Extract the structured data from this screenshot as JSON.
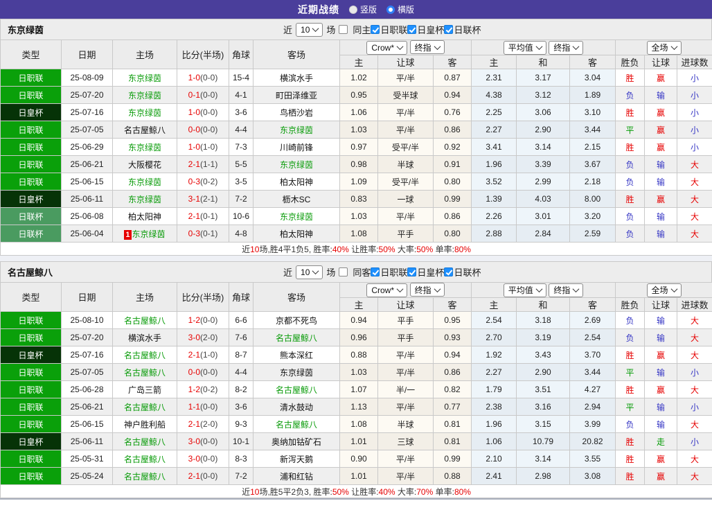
{
  "title_bar": {
    "title": "近期战绩",
    "vertical": "竖版",
    "horizontal": "横版"
  },
  "filters": {
    "near": "近",
    "count": "10",
    "games": "场"
  },
  "table_header": {
    "left_cols": [
      "类型",
      "日期",
      "主场",
      "比分(半场)",
      "角球",
      "客场"
    ],
    "crow_select": "Crow*",
    "final_select": "终指",
    "avg_select": "平均值",
    "avg_final_select": "终指",
    "full_select": "全场",
    "sub_cols": [
      "主",
      "让球",
      "客",
      "主",
      "和",
      "客",
      "胜负",
      "让球",
      "进球数"
    ]
  },
  "colors": {
    "accent_purple": "#4a3e9b",
    "league_green": "#0aa00a",
    "cup_dark_green": "#063307",
    "leaguecup_green": "#4a9b60",
    "focus_team_green": "#089b08",
    "win_red": "#e60000",
    "lose_blue": "#3535c4",
    "checkbox_blue": "#1e90ff"
  },
  "sections": [
    {
      "team": "东京绿茵",
      "same_label": "同主",
      "league_filters": [
        "日职联",
        "日皇杯",
        "日联杯"
      ],
      "rows": [
        {
          "type": "日职联",
          "tc": "jl",
          "date": "25-08-09",
          "home": "东京绿茵",
          "hf": true,
          "badge": "",
          "score": "1-0",
          "half": "(0-0)",
          "corner": "15-4",
          "away": "横滨水手",
          "af": false,
          "c1": "1.02",
          "hc": "平/半",
          "c2": "0.87",
          "m1": "2.31",
          "m2": "3.17",
          "m3": "3.04",
          "r1": "胜",
          "r1c": "red",
          "r2": "赢",
          "r2c": "red",
          "r3": "小",
          "r3c": "blue"
        },
        {
          "type": "日职联",
          "tc": "jl",
          "date": "25-07-20",
          "home": "东京绿茵",
          "hf": true,
          "badge": "",
          "score": "0-1",
          "half": "(0-0)",
          "corner": "4-1",
          "away": "町田泽维亚",
          "af": false,
          "c1": "0.95",
          "hc": "受半球",
          "c2": "0.94",
          "m1": "4.38",
          "m2": "3.12",
          "m3": "1.89",
          "r1": "负",
          "r1c": "blue",
          "r2": "输",
          "r2c": "blue",
          "r3": "小",
          "r3c": "blue"
        },
        {
          "type": "日皇杯",
          "tc": "cup",
          "date": "25-07-16",
          "home": "东京绿茵",
          "hf": true,
          "badge": "",
          "score": "1-0",
          "half": "(0-0)",
          "corner": "3-6",
          "away": "鸟栖沙岩",
          "af": false,
          "c1": "1.06",
          "hc": "平/半",
          "c2": "0.76",
          "m1": "2.25",
          "m2": "3.06",
          "m3": "3.10",
          "r1": "胜",
          "r1c": "red",
          "r2": "赢",
          "r2c": "red",
          "r3": "小",
          "r3c": "blue"
        },
        {
          "type": "日职联",
          "tc": "jl",
          "date": "25-07-05",
          "home": "名古屋鲸八",
          "hf": false,
          "badge": "",
          "score": "0-0",
          "half": "(0-0)",
          "corner": "4-4",
          "away": "东京绿茵",
          "af": true,
          "c1": "1.03",
          "hc": "平/半",
          "c2": "0.86",
          "m1": "2.27",
          "m2": "2.90",
          "m3": "3.44",
          "r1": "平",
          "r1c": "green",
          "r2": "赢",
          "r2c": "red",
          "r3": "小",
          "r3c": "blue"
        },
        {
          "type": "日职联",
          "tc": "jl",
          "date": "25-06-29",
          "home": "东京绿茵",
          "hf": true,
          "badge": "",
          "score": "1-0",
          "half": "(1-0)",
          "corner": "7-3",
          "away": "川崎前锋",
          "af": false,
          "c1": "0.97",
          "hc": "受平/半",
          "c2": "0.92",
          "m1": "3.41",
          "m2": "3.14",
          "m3": "2.15",
          "r1": "胜",
          "r1c": "red",
          "r2": "赢",
          "r2c": "red",
          "r3": "小",
          "r3c": "blue"
        },
        {
          "type": "日职联",
          "tc": "jl",
          "date": "25-06-21",
          "home": "大阪樱花",
          "hf": false,
          "badge": "",
          "score": "2-1",
          "half": "(1-1)",
          "corner": "5-5",
          "away": "东京绿茵",
          "af": true,
          "c1": "0.98",
          "hc": "半球",
          "c2": "0.91",
          "m1": "1.96",
          "m2": "3.39",
          "m3": "3.67",
          "r1": "负",
          "r1c": "blue",
          "r2": "输",
          "r2c": "blue",
          "r3": "大",
          "r3c": "red"
        },
        {
          "type": "日职联",
          "tc": "jl",
          "date": "25-06-15",
          "home": "东京绿茵",
          "hf": true,
          "badge": "",
          "score": "0-3",
          "half": "(0-2)",
          "corner": "3-5",
          "away": "柏太阳神",
          "af": false,
          "c1": "1.09",
          "hc": "受平/半",
          "c2": "0.80",
          "m1": "3.52",
          "m2": "2.99",
          "m3": "2.18",
          "r1": "负",
          "r1c": "blue",
          "r2": "输",
          "r2c": "blue",
          "r3": "大",
          "r3c": "red"
        },
        {
          "type": "日皇杯",
          "tc": "cup",
          "date": "25-06-11",
          "home": "东京绿茵",
          "hf": true,
          "badge": "",
          "score": "3-1",
          "half": "(2-1)",
          "corner": "7-2",
          "away": "枥木SC",
          "af": false,
          "c1": "0.83",
          "hc": "一球",
          "c2": "0.99",
          "m1": "1.39",
          "m2": "4.03",
          "m3": "8.00",
          "r1": "胜",
          "r1c": "red",
          "r2": "赢",
          "r2c": "red",
          "r3": "大",
          "r3c": "red"
        },
        {
          "type": "日联杯",
          "tc": "lc",
          "date": "25-06-08",
          "home": "柏太阳神",
          "hf": false,
          "badge": "",
          "score": "2-1",
          "half": "(0-1)",
          "corner": "10-6",
          "away": "东京绿茵",
          "af": true,
          "c1": "1.03",
          "hc": "平/半",
          "c2": "0.86",
          "m1": "2.26",
          "m2": "3.01",
          "m3": "3.20",
          "r1": "负",
          "r1c": "blue",
          "r2": "输",
          "r2c": "blue",
          "r3": "大",
          "r3c": "red"
        },
        {
          "type": "日联杯",
          "tc": "lc",
          "date": "25-06-04",
          "home": "东京绿茵",
          "hf": true,
          "badge": "1",
          "score": "0-3",
          "half": "(0-1)",
          "corner": "4-8",
          "away": "柏太阳神",
          "af": false,
          "c1": "1.08",
          "hc": "平手",
          "c2": "0.80",
          "m1": "2.88",
          "m2": "2.84",
          "m3": "2.59",
          "r1": "负",
          "r1c": "blue",
          "r2": "输",
          "r2c": "blue",
          "r3": "大",
          "r3c": "red"
        }
      ],
      "summary": [
        {
          "t": "近",
          "red": false
        },
        {
          "t": "10",
          "red": true
        },
        {
          "t": "场,胜4平1负5, 胜率:",
          "red": false
        },
        {
          "t": "40%",
          "red": true
        },
        {
          "t": " 让胜率:",
          "red": false
        },
        {
          "t": "50%",
          "red": true
        },
        {
          "t": " 大率:",
          "red": false
        },
        {
          "t": "50%",
          "red": true
        },
        {
          "t": " 单率:",
          "red": false
        },
        {
          "t": "80%",
          "red": true
        }
      ]
    },
    {
      "team": "名古屋鲸八",
      "same_label": "同客",
      "league_filters": [
        "日职联",
        "日皇杯",
        "日联杯"
      ],
      "rows": [
        {
          "type": "日职联",
          "tc": "jl",
          "date": "25-08-10",
          "home": "名古屋鲸八",
          "hf": true,
          "badge": "",
          "score": "1-2",
          "half": "(0-0)",
          "corner": "6-6",
          "away": "京都不死鸟",
          "af": false,
          "c1": "0.94",
          "hc": "平手",
          "c2": "0.95",
          "m1": "2.54",
          "m2": "3.18",
          "m3": "2.69",
          "r1": "负",
          "r1c": "blue",
          "r2": "输",
          "r2c": "blue",
          "r3": "大",
          "r3c": "red"
        },
        {
          "type": "日职联",
          "tc": "jl",
          "date": "25-07-20",
          "home": "横滨水手",
          "hf": false,
          "badge": "",
          "score": "3-0",
          "half": "(2-0)",
          "corner": "7-6",
          "away": "名古屋鲸八",
          "af": true,
          "c1": "0.96",
          "hc": "平手",
          "c2": "0.93",
          "m1": "2.70",
          "m2": "3.19",
          "m3": "2.54",
          "r1": "负",
          "r1c": "blue",
          "r2": "输",
          "r2c": "blue",
          "r3": "大",
          "r3c": "red"
        },
        {
          "type": "日皇杯",
          "tc": "cup",
          "date": "25-07-16",
          "home": "名古屋鲸八",
          "hf": true,
          "badge": "",
          "score": "2-1",
          "half": "(1-0)",
          "corner": "8-7",
          "away": "熊本深红",
          "af": false,
          "c1": "0.88",
          "hc": "平/半",
          "c2": "0.94",
          "m1": "1.92",
          "m2": "3.43",
          "m3": "3.70",
          "r1": "胜",
          "r1c": "red",
          "r2": "赢",
          "r2c": "red",
          "r3": "大",
          "r3c": "red"
        },
        {
          "type": "日职联",
          "tc": "jl",
          "date": "25-07-05",
          "home": "名古屋鲸八",
          "hf": true,
          "badge": "",
          "score": "0-0",
          "half": "(0-0)",
          "corner": "4-4",
          "away": "东京绿茵",
          "af": false,
          "c1": "1.03",
          "hc": "平/半",
          "c2": "0.86",
          "m1": "2.27",
          "m2": "2.90",
          "m3": "3.44",
          "r1": "平",
          "r1c": "green",
          "r2": "输",
          "r2c": "blue",
          "r3": "小",
          "r3c": "blue"
        },
        {
          "type": "日职联",
          "tc": "jl",
          "date": "25-06-28",
          "home": "广岛三箭",
          "hf": false,
          "badge": "",
          "score": "1-2",
          "half": "(0-2)",
          "corner": "8-2",
          "away": "名古屋鲸八",
          "af": true,
          "c1": "1.07",
          "hc": "半/一",
          "c2": "0.82",
          "m1": "1.79",
          "m2": "3.51",
          "m3": "4.27",
          "r1": "胜",
          "r1c": "red",
          "r2": "赢",
          "r2c": "red",
          "r3": "大",
          "r3c": "red"
        },
        {
          "type": "日职联",
          "tc": "jl",
          "date": "25-06-21",
          "home": "名古屋鲸八",
          "hf": true,
          "badge": "",
          "score": "1-1",
          "half": "(0-0)",
          "corner": "3-6",
          "away": "清水鼓动",
          "af": false,
          "c1": "1.13",
          "hc": "平/半",
          "c2": "0.77",
          "m1": "2.38",
          "m2": "3.16",
          "m3": "2.94",
          "r1": "平",
          "r1c": "green",
          "r2": "输",
          "r2c": "blue",
          "r3": "小",
          "r3c": "blue"
        },
        {
          "type": "日职联",
          "tc": "jl",
          "date": "25-06-15",
          "home": "神户胜利船",
          "hf": false,
          "badge": "",
          "score": "2-1",
          "half": "(2-0)",
          "corner": "9-3",
          "away": "名古屋鲸八",
          "af": true,
          "c1": "1.08",
          "hc": "半球",
          "c2": "0.81",
          "m1": "1.96",
          "m2": "3.15",
          "m3": "3.99",
          "r1": "负",
          "r1c": "blue",
          "r2": "输",
          "r2c": "blue",
          "r3": "大",
          "r3c": "red"
        },
        {
          "type": "日皇杯",
          "tc": "cup",
          "date": "25-06-11",
          "home": "名古屋鲸八",
          "hf": true,
          "badge": "",
          "score": "3-0",
          "half": "(0-0)",
          "corner": "10-1",
          "away": "奥纳加钴矿石",
          "af": false,
          "c1": "1.01",
          "hc": "三球",
          "c2": "0.81",
          "m1": "1.06",
          "m2": "10.79",
          "m3": "20.82",
          "r1": "胜",
          "r1c": "red",
          "r2": "走",
          "r2c": "green",
          "r3": "小",
          "r3c": "blue"
        },
        {
          "type": "日职联",
          "tc": "jl",
          "date": "25-05-31",
          "home": "名古屋鲸八",
          "hf": true,
          "badge": "",
          "score": "3-0",
          "half": "(0-0)",
          "corner": "8-3",
          "away": "新泻天鹅",
          "af": false,
          "c1": "0.90",
          "hc": "平/半",
          "c2": "0.99",
          "m1": "2.10",
          "m2": "3.14",
          "m3": "3.55",
          "r1": "胜",
          "r1c": "red",
          "r2": "赢",
          "r2c": "red",
          "r3": "大",
          "r3c": "red"
        },
        {
          "type": "日职联",
          "tc": "jl",
          "date": "25-05-24",
          "home": "名古屋鲸八",
          "hf": true,
          "badge": "",
          "score": "2-1",
          "half": "(0-0)",
          "corner": "7-2",
          "away": "浦和红钻",
          "af": false,
          "c1": "1.01",
          "hc": "平/半",
          "c2": "0.88",
          "m1": "2.41",
          "m2": "2.98",
          "m3": "3.08",
          "r1": "胜",
          "r1c": "red",
          "r2": "赢",
          "r2c": "red",
          "r3": "大",
          "r3c": "red"
        }
      ],
      "summary": [
        {
          "t": "近",
          "red": false
        },
        {
          "t": "10",
          "red": true
        },
        {
          "t": "场,胜5平2负3, 胜率:",
          "red": false
        },
        {
          "t": "50%",
          "red": true
        },
        {
          "t": " 让胜率:",
          "red": false
        },
        {
          "t": "40%",
          "red": true
        },
        {
          "t": " 大率:",
          "red": false
        },
        {
          "t": "70%",
          "red": true
        },
        {
          "t": " 单率:",
          "red": false
        },
        {
          "t": "80%",
          "red": true
        }
      ]
    }
  ]
}
